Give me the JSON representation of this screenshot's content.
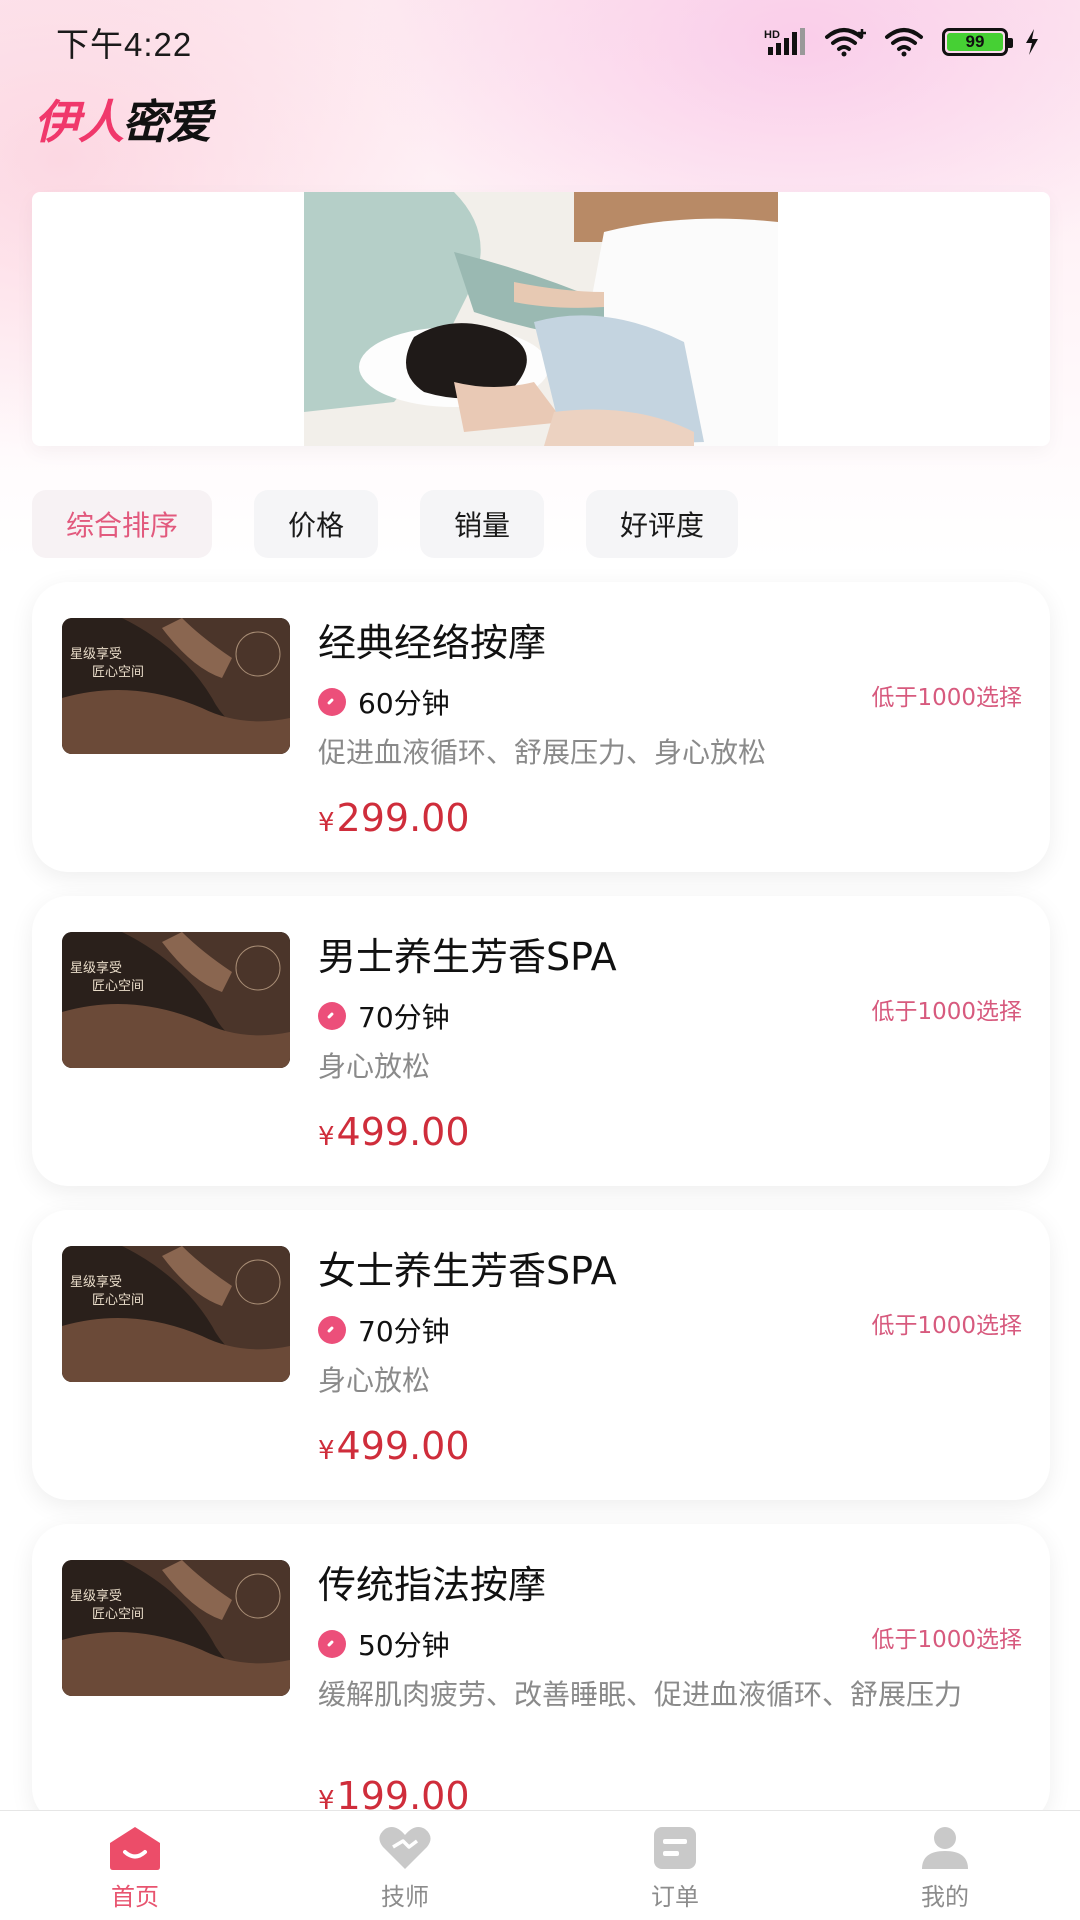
{
  "status_bar": {
    "time": "下午4:22",
    "battery": "99",
    "network": "HD"
  },
  "brand": {
    "part1": "伊人",
    "part2": "密爱"
  },
  "sort_options": [
    {
      "label": "综合排序",
      "active": true
    },
    {
      "label": "价格",
      "active": false
    },
    {
      "label": "销量",
      "active": false
    },
    {
      "label": "好评度",
      "active": false
    }
  ],
  "services": [
    {
      "title": "经典经络按摩",
      "duration": "60分钟",
      "tag": "低于1000选择",
      "desc": "促进血液循环、舒展压力、身心放松",
      "currency": "¥",
      "price": "299.00"
    },
    {
      "title": "男士养生芳香SPA",
      "duration": "70分钟",
      "tag": "低于1000选择",
      "desc": "身心放松",
      "currency": "¥",
      "price": "499.00"
    },
    {
      "title": "女士养生芳香SPA",
      "duration": "70分钟",
      "tag": "低于1000选择",
      "desc": "身心放松",
      "currency": "¥",
      "price": "499.00"
    },
    {
      "title": "传统指法按摩",
      "duration": "50分钟",
      "tag": "低于1000选择",
      "desc": "缓解肌肉疲劳、改善睡眠、促进血液循环、舒展压力",
      "currency": "¥",
      "price": "199.00"
    }
  ],
  "thumb_text": {
    "line1": "星级享受",
    "line2": "匠心空间"
  },
  "tabbar": [
    {
      "label": "首页",
      "icon": "home-icon",
      "active": true
    },
    {
      "label": "技师",
      "icon": "heart-icon",
      "active": false
    },
    {
      "label": "订单",
      "icon": "order-icon",
      "active": false
    },
    {
      "label": "我的",
      "icon": "user-icon",
      "active": false
    }
  ],
  "colors": {
    "accent": "#e8546f",
    "price": "#cf2d3b",
    "tag": "#d75a7e",
    "brand_pink": "#f0386b"
  }
}
